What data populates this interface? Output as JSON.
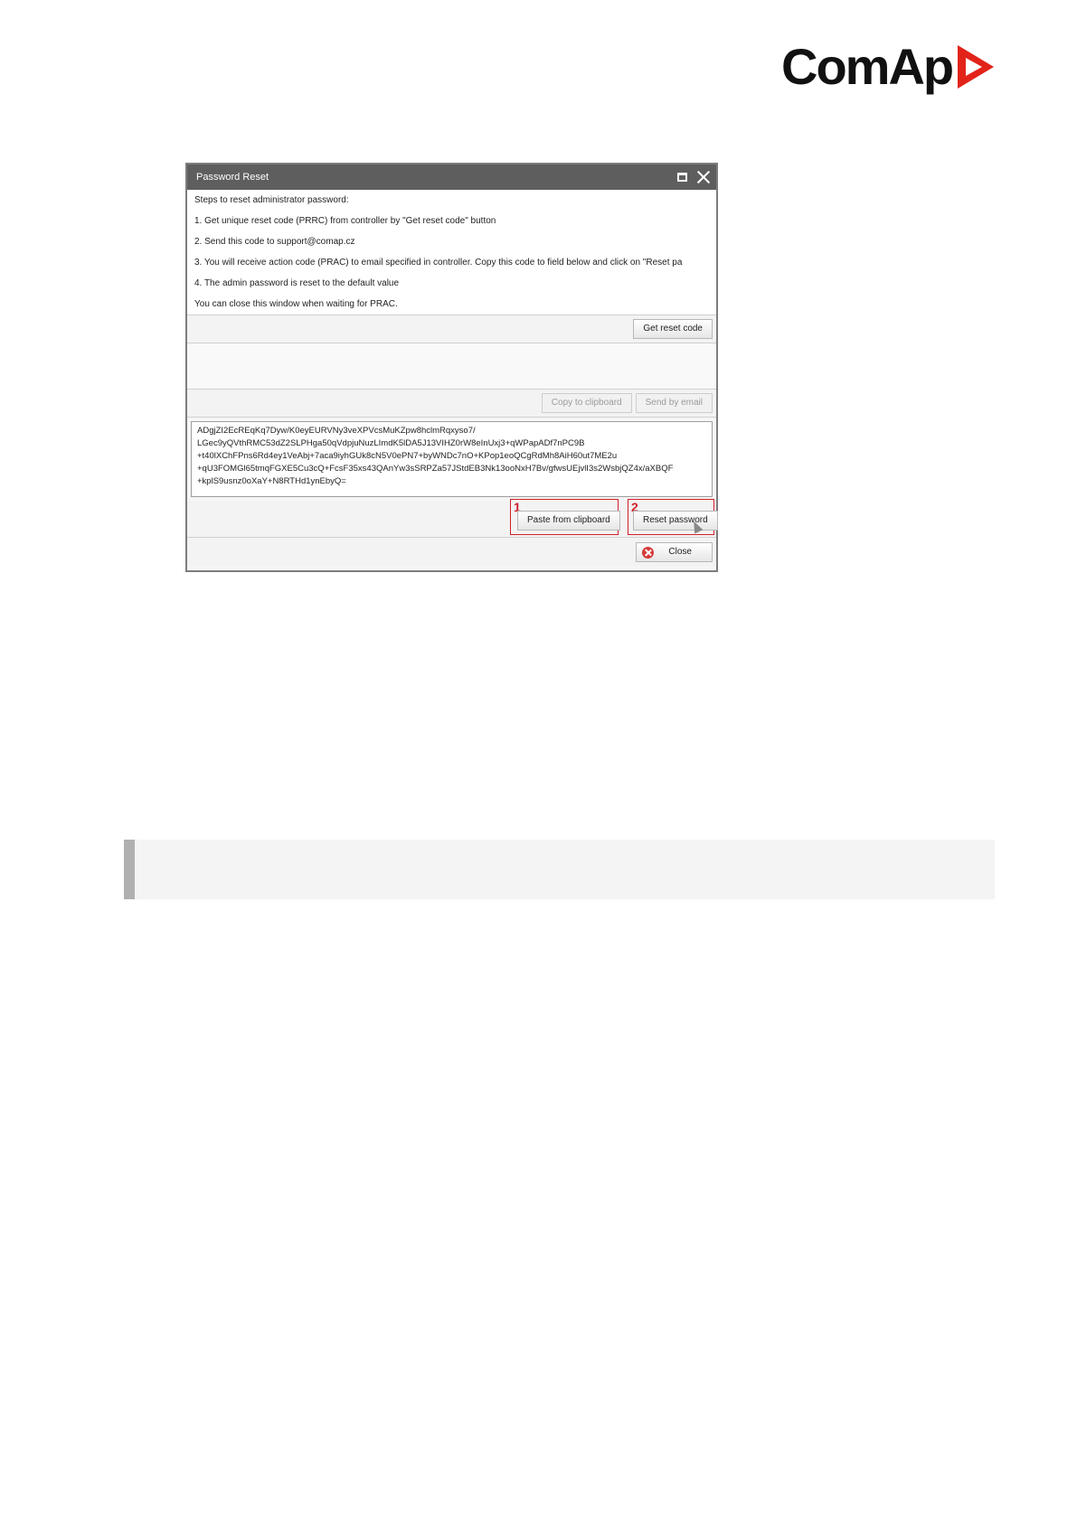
{
  "brand": {
    "name": "ComAp",
    "accent": "#e2231a"
  },
  "dialog": {
    "title": "Password Reset",
    "steps": [
      "Steps to reset administrator password:",
      "1. Get unique reset code (PRRC) from controller by \"Get reset code\" button",
      "2. Send this code to support@comap.cz",
      "3. You will receive action code (PRAC) to email specified in controller. Copy this code to field below and click on \"Reset pa",
      "4. The admin password is reset to the default value",
      "You can close this window when waiting for PRAC."
    ],
    "get_reset_code_label": "Get reset code",
    "copy_to_clipboard_label": "Copy to clipboard",
    "send_by_email_label": "Send by email",
    "code_lines": [
      "ADgjZI2EcREqKq7Dyw/K0eyEURVNy3veXPVcsMuKZpw8hclmRqxyso7/",
      "LGec9yQVthRMC53dZ2SLPHga50qVdpjuNuzLImdK5lDA5J13VIHZ0rW8eInUxj3+qWPapADf7nPC9B",
      "+t40lXChFPns6Rd4ey1VeAbj+7aca9iyhGUk8cN5V0ePN7+byWNDc7nO+KPop1eoQCgRdMh8AiH60ut7ME2u",
      "+qU3FOMGl65tmqFGXE5Cu3cQ+FcsF35xs43QAnYw3sSRPZa57JStdEB3Nk13ooNxH7Bv/gfwsUEjvlI3s2WsbjQZ4x/aXBQF",
      "+kplS9usnz0oXaY+N8RTHd1ynEbyQ="
    ],
    "paste_label": "Paste from clipboard",
    "reset_label": "Reset password",
    "close_label": "Close",
    "marker_1": "1",
    "marker_2": "2"
  }
}
